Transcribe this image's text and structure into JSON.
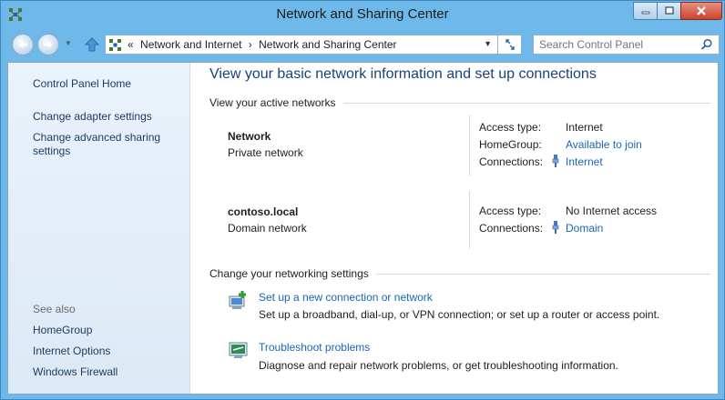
{
  "window": {
    "title": "Network and Sharing Center",
    "controls": {
      "minimize": "minimize",
      "maximize": "maximize",
      "close": "close"
    }
  },
  "navbar": {
    "breadcrumb_overflow": "«",
    "breadcrumbs": [
      "Network and Internet",
      "Network and Sharing Center"
    ],
    "search_placeholder": "Search Control Panel"
  },
  "sidebar": {
    "home": "Control Panel Home",
    "links": [
      "Change adapter settings",
      "Change advanced sharing settings"
    ],
    "see_also_label": "See also",
    "see_also": [
      "HomeGroup",
      "Internet Options",
      "Windows Firewall"
    ]
  },
  "main": {
    "title": "View your basic network information and set up connections",
    "active_networks_heading": "View your active networks",
    "networks": [
      {
        "name": "Network",
        "category": "Private network",
        "rows": [
          {
            "label": "Access type:",
            "value": "Internet",
            "link": false
          },
          {
            "label": "HomeGroup:",
            "value": "Available to join",
            "link": true
          },
          {
            "label": "Connections:",
            "value": "Internet",
            "link": true,
            "icon": "ethernet-icon"
          }
        ]
      },
      {
        "name": "contoso.local",
        "category": "Domain network",
        "rows": [
          {
            "label": "Access type:",
            "value": "No Internet access",
            "link": false
          },
          {
            "label": "Connections:",
            "value": "Domain",
            "link": true,
            "icon": "ethernet-icon"
          }
        ]
      }
    ],
    "settings_heading": "Change your networking settings",
    "tasks": [
      {
        "title": "Set up a new connection or network",
        "description": "Set up a broadband, dial-up, or VPN connection; or set up a router or access point.",
        "icon": "new-connection-icon"
      },
      {
        "title": "Troubleshoot problems",
        "description": "Diagnose and repair network problems, or get troubleshooting information.",
        "icon": "troubleshoot-icon"
      }
    ]
  },
  "colors": {
    "frame": "#6fb9ea",
    "link": "#1a66b8",
    "title": "#1e3f78",
    "sidebar": "#dce9f6"
  }
}
